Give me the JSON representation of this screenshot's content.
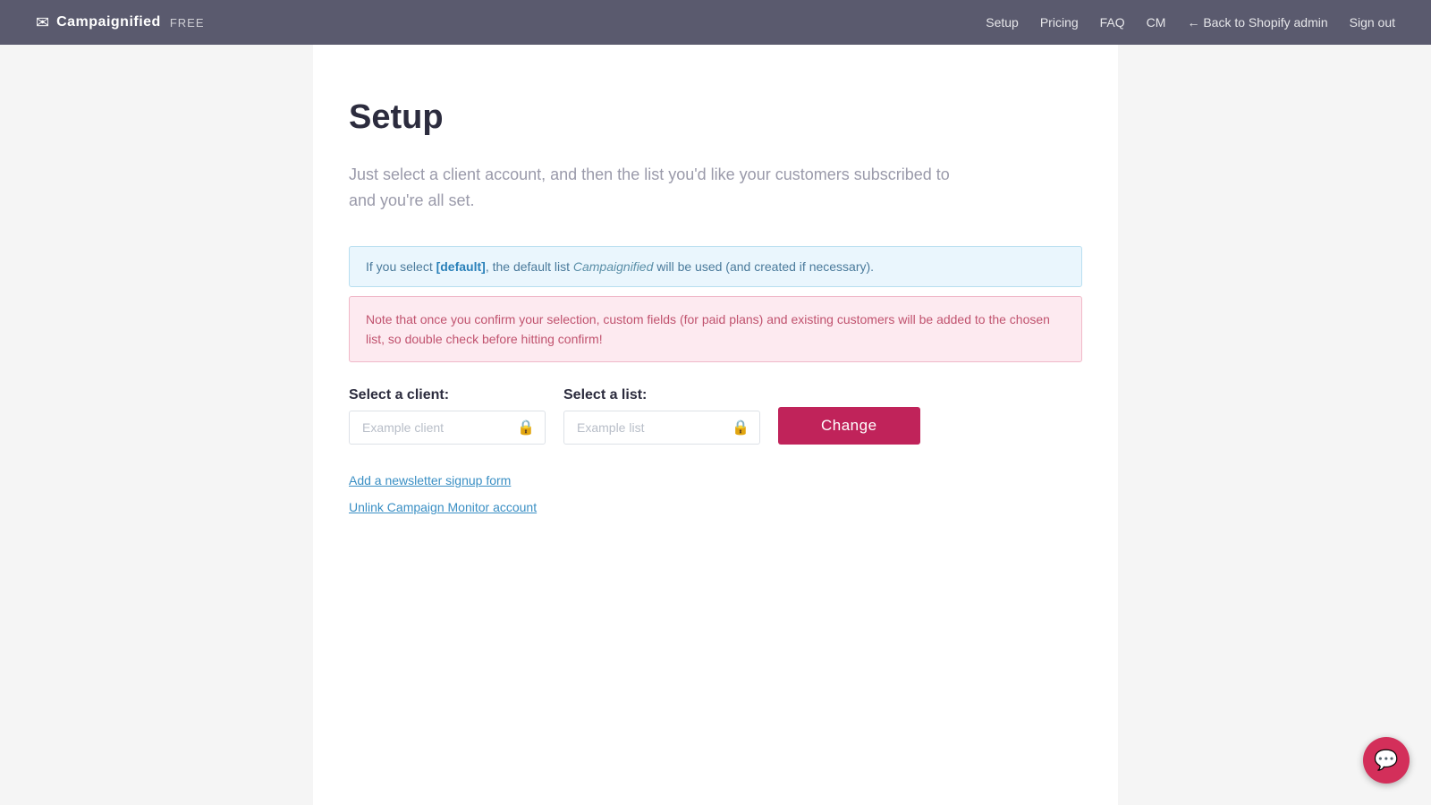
{
  "header": {
    "brand_name": "Campaignified",
    "brand_plan": "FREE",
    "nav": {
      "setup": "Setup",
      "pricing": "Pricing",
      "faq": "FAQ",
      "cm": "CM",
      "back_to_shopify": "← Back to Shopify admin",
      "sign_out": "Sign out"
    }
  },
  "main": {
    "page_title": "Setup",
    "page_description": "Just select a client account, and then the list you'd like your customers subscribed to and you're all set.",
    "info_box": {
      "text_before": "If you select ",
      "highlight": "[default]",
      "text_after": ", the default list ",
      "italic": "Campaignified",
      "text_end": " will be used (and created if necessary)."
    },
    "warning_box": "Note that once you confirm your selection, custom fields (for paid plans) and existing customers will be added to the chosen list, so double check before hitting confirm!",
    "client_label": "Select a client:",
    "client_placeholder": "Example client",
    "list_label": "Select a list:",
    "list_placeholder": "Example list",
    "change_button": "Change",
    "link_newsletter": "Add a newsletter signup form",
    "link_unlink": "Unlink Campaign Monitor account"
  }
}
